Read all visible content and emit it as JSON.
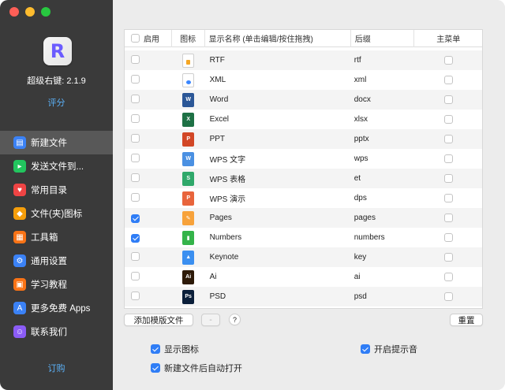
{
  "app": {
    "version_label": "超级右键: 2.1.9",
    "rate_link": "评分",
    "subscribe_link": "订购",
    "icon_glyph": "R"
  },
  "sidebar": {
    "items": [
      {
        "label": "新建文件",
        "icon": "new-file-icon",
        "color": "#3b82f6",
        "glyph": "▤",
        "active": true
      },
      {
        "label": "发送文件到...",
        "icon": "send-file-icon",
        "color": "#22c55e",
        "glyph": "▸",
        "active": false
      },
      {
        "label": "常用目录",
        "icon": "heart-icon",
        "color": "#ef4444",
        "glyph": "♥",
        "active": false
      },
      {
        "label": "文件(夹)图标",
        "icon": "icon-badge-icon",
        "color": "#f59e0b",
        "glyph": "◆",
        "active": false
      },
      {
        "label": "工具箱",
        "icon": "toolbox-icon",
        "color": "#f97316",
        "glyph": "▦",
        "active": false
      },
      {
        "label": "通用设置",
        "icon": "gear-icon",
        "color": "#3b82f6",
        "glyph": "⚙",
        "active": false
      },
      {
        "label": "学习教程",
        "icon": "tutorial-icon",
        "color": "#f97316",
        "glyph": "▣",
        "active": false
      },
      {
        "label": "更多免费 Apps",
        "icon": "app-store-icon",
        "color": "#3b82f6",
        "glyph": "A",
        "active": false
      },
      {
        "label": "联系我们",
        "icon": "contact-icon",
        "color": "#8b5cf6",
        "glyph": "☺",
        "active": false
      }
    ]
  },
  "table": {
    "headers": {
      "enable": "启用",
      "icon": "图标",
      "name": "显示名称 (单击编辑/按住拖拽)",
      "suffix": "后缀",
      "menu": "主菜单"
    },
    "rows": [
      {
        "name": "RTF",
        "suffix": "rtf",
        "enabled": false,
        "main_menu": false,
        "icon": "rtf-file-icon",
        "icon_color": "#ffffff",
        "icon_glyph": ""
      },
      {
        "name": "XML",
        "suffix": "xml",
        "enabled": false,
        "main_menu": false,
        "icon": "xml-file-icon",
        "icon_color": "#ffffff",
        "icon_glyph": ""
      },
      {
        "name": "Word",
        "suffix": "docx",
        "enabled": false,
        "main_menu": false,
        "icon": "word-icon",
        "icon_color": "#2b5797",
        "icon_glyph": "W"
      },
      {
        "name": "Excel",
        "suffix": "xlsx",
        "enabled": false,
        "main_menu": false,
        "icon": "excel-icon",
        "icon_color": "#1e7145",
        "icon_glyph": "X"
      },
      {
        "name": "PPT",
        "suffix": "pptx",
        "enabled": false,
        "main_menu": false,
        "icon": "powerpoint-icon",
        "icon_color": "#d24726",
        "icon_glyph": "P"
      },
      {
        "name": "WPS 文字",
        "suffix": "wps",
        "enabled": false,
        "main_menu": false,
        "icon": "wps-writer-icon",
        "icon_color": "#4a90e2",
        "icon_glyph": "W"
      },
      {
        "name": "WPS 表格",
        "suffix": "et",
        "enabled": false,
        "main_menu": false,
        "icon": "wps-spreadsheet-icon",
        "icon_color": "#2fa86a",
        "icon_glyph": "S"
      },
      {
        "name": "WPS 演示",
        "suffix": "dps",
        "enabled": false,
        "main_menu": false,
        "icon": "wps-presentation-icon",
        "icon_color": "#e8643c",
        "icon_glyph": "P"
      },
      {
        "name": "Pages",
        "suffix": "pages",
        "enabled": true,
        "main_menu": false,
        "icon": "pages-icon",
        "icon_color": "#f7a23b",
        "icon_glyph": "✎"
      },
      {
        "name": "Numbers",
        "suffix": "numbers",
        "enabled": true,
        "main_menu": false,
        "icon": "numbers-icon",
        "icon_color": "#34b34a",
        "icon_glyph": "▮"
      },
      {
        "name": "Keynote",
        "suffix": "key",
        "enabled": false,
        "main_menu": false,
        "icon": "keynote-icon",
        "icon_color": "#3b8ff0",
        "icon_glyph": "▲"
      },
      {
        "name": "Ai",
        "suffix": "ai",
        "enabled": false,
        "main_menu": false,
        "icon": "illustrator-icon",
        "icon_color": "#2d1a08",
        "icon_glyph": "Ai"
      },
      {
        "name": "PSD",
        "suffix": "psd",
        "enabled": false,
        "main_menu": false,
        "icon": "photoshop-icon",
        "icon_color": "#0b1f3a",
        "icon_glyph": "Ps"
      }
    ]
  },
  "toolbar": {
    "add_template_label": "添加模版文件",
    "remove_label": "-",
    "help_label": "?",
    "reset_label": "重置"
  },
  "options": {
    "show_icon_label": "显示图标",
    "show_icon_checked": true,
    "auto_open_label": "新建文件后自动打开",
    "auto_open_checked": true,
    "sound_label": "开启提示音",
    "sound_checked": true
  }
}
